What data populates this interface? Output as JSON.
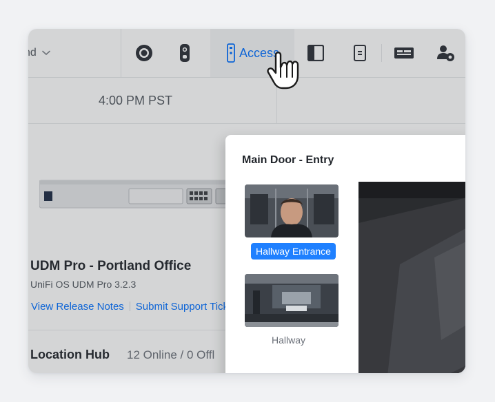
{
  "nav": {
    "site_label": "nd",
    "active_tab_label": "Access",
    "icons": [
      "protect-icon",
      "doorbell-icon",
      "access-icon",
      "door-hub-icon",
      "reader-icon",
      "console-icon",
      "user-settings-icon"
    ]
  },
  "timeline": {
    "time_label": "4:00 PM PST"
  },
  "device": {
    "name": "UDM Pro - Portland Office",
    "os_version": "UniFi OS UDM Pro 3.2.3",
    "link_release_notes": "View Release Notes",
    "link_support": "Submit Support Tick"
  },
  "hub": {
    "label": "Location Hub",
    "status": "12 Online / 0 Offl"
  },
  "door_panel": {
    "title": "Main Door - Entry",
    "cameras": [
      {
        "label": "Hallway Entrance",
        "selected": true
      },
      {
        "label": "Hallway",
        "selected": false
      }
    ]
  },
  "colors": {
    "accent": "#006fff",
    "selected_badge": "#1f80ff",
    "text_primary": "#1f2329",
    "text_secondary": "#50565e"
  }
}
